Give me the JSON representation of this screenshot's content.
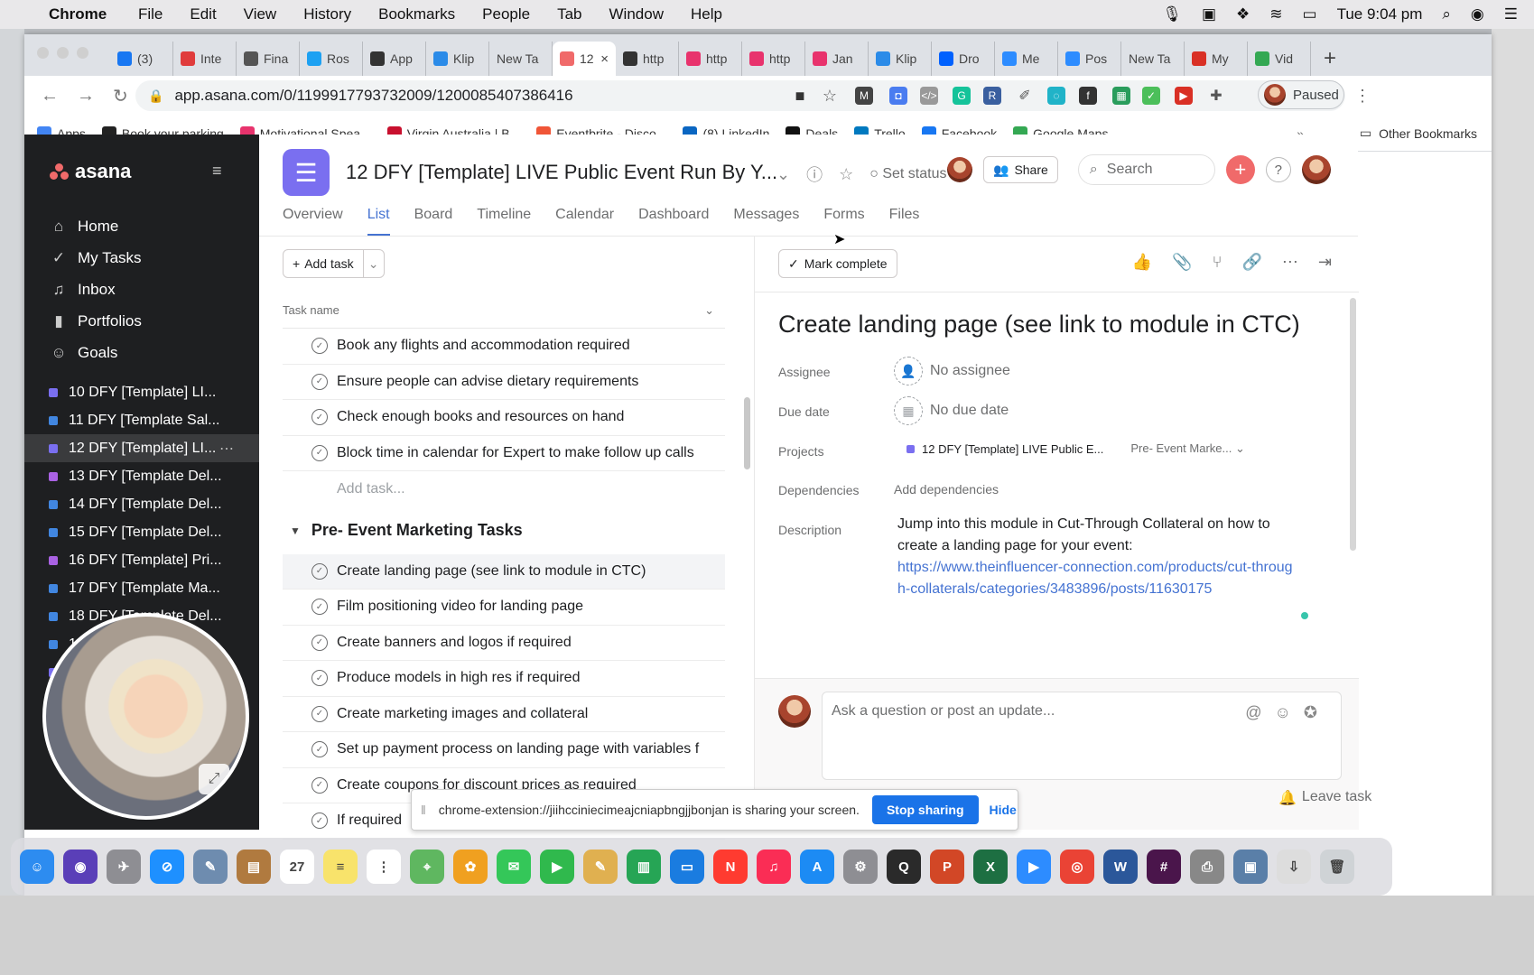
{
  "macos_menu": {
    "app": "Chrome",
    "items": [
      "File",
      "Edit",
      "View",
      "History",
      "Bookmarks",
      "People",
      "Tab",
      "Window",
      "Help"
    ],
    "clock": "Tue 9:04 pm"
  },
  "browser": {
    "tabs": [
      {
        "label": "(3)",
        "color": "#1877f2",
        "icon": "calendar-icon"
      },
      {
        "label": "Inte",
        "color": "#e03c3c",
        "icon": "card-icon"
      },
      {
        "label": "Fina",
        "color": "#555555",
        "icon": "doc-icon"
      },
      {
        "label": "Ros",
        "color": "#1da1f2",
        "icon": "twitter-icon"
      },
      {
        "label": "App",
        "color": "#333333",
        "icon": "globe-icon"
      },
      {
        "label": "Klip",
        "color": "#2b8be8",
        "icon": "klip-icon"
      },
      {
        "label": "New Ta",
        "color": "#ffffff",
        "icon": "none"
      },
      {
        "label": "12",
        "color": "#f06a6a",
        "icon": "recording-icon",
        "active": true
      },
      {
        "label": "http",
        "color": "#333333",
        "icon": "globe-icon"
      },
      {
        "label": "http",
        "color": "#e8336d",
        "icon": "pin-icon"
      },
      {
        "label": "http",
        "color": "#e8336d",
        "icon": "pin-icon"
      },
      {
        "label": "Jan",
        "color": "#e8336d",
        "icon": "pin-icon"
      },
      {
        "label": "Klip",
        "color": "#2b8be8",
        "icon": "klip-icon"
      },
      {
        "label": "Dro",
        "color": "#0061fe",
        "icon": "dropbox-icon"
      },
      {
        "label": "Me",
        "color": "#2d8cff",
        "icon": "zoom-icon"
      },
      {
        "label": "Pos",
        "color": "#2d8cff",
        "icon": "zoom-icon"
      },
      {
        "label": "New Ta",
        "color": "#ffffff",
        "icon": "none"
      },
      {
        "label": "My",
        "color": "#d93025",
        "icon": "video-icon"
      },
      {
        "label": "Vid",
        "color": "#34a853",
        "icon": "leaf-icon"
      }
    ],
    "url": "app.asana.com/0/1199917793732009/1200085407386416",
    "profile_label": "Paused"
  },
  "bookmarks": [
    {
      "label": "Apps",
      "color": "#4285f4"
    },
    {
      "label": "Book your parking",
      "color": "#222222"
    },
    {
      "label": "Motivational Spea...",
      "color": "#e8336d"
    },
    {
      "label": "Virgin Australia | B...",
      "color": "#c8102e"
    },
    {
      "label": "Eventbrite - Disco...",
      "color": "#f05537"
    },
    {
      "label": "(8) LinkedIn",
      "color": "#0a66c2"
    },
    {
      "label": "Deals",
      "color": "#111111"
    },
    {
      "label": "Trello",
      "color": "#0079bf"
    },
    {
      "label": "Facebook",
      "color": "#1877f2"
    },
    {
      "label": "Google Maps",
      "color": "#34a853"
    }
  ],
  "bookmarks_more": "»",
  "bookmarks_other": "Other Bookmarks",
  "sidebar": {
    "logo": "asana",
    "nav": [
      {
        "label": "Home",
        "icon": "home-icon"
      },
      {
        "label": "My Tasks",
        "icon": "check-circle-icon"
      },
      {
        "label": "Inbox",
        "icon": "bell-icon"
      },
      {
        "label": "Portfolios",
        "icon": "bar-chart-icon"
      },
      {
        "label": "Goals",
        "icon": "person-icon"
      }
    ],
    "projects": [
      {
        "label": "10 DFY [Template] LI...",
        "color": "#7a6ff0"
      },
      {
        "label": "11 DFY [Template Sal...",
        "color": "#4186e0"
      },
      {
        "label": "12 DFY [Template] LI...",
        "color": "#7a6ff0",
        "selected": true
      },
      {
        "label": "13 DFY [Template Del...",
        "color": "#aa62e3"
      },
      {
        "label": "14 DFY [Template Del...",
        "color": "#4186e0"
      },
      {
        "label": "15 DFY [Template Del...",
        "color": "#4186e0"
      },
      {
        "label": "16 DFY [Template] Pri...",
        "color": "#aa62e3"
      },
      {
        "label": "17 DFY [Template Ma...",
        "color": "#4186e0"
      },
      {
        "label": "18 DFY [Template Del...",
        "color": "#4186e0"
      },
      {
        "label": "19",
        "color": "#4186e0"
      },
      {
        "label": "",
        "color": "#7a6ff0"
      }
    ]
  },
  "project": {
    "title": "12 DFY [Template] LIVE Public Event Run By Y...",
    "set_status": "Set status",
    "share": "Share",
    "search_placeholder": "Search",
    "tabs": [
      "Overview",
      "List",
      "Board",
      "Timeline",
      "Calendar",
      "Dashboard",
      "Messages",
      "Forms",
      "Files"
    ],
    "active_tab": "List"
  },
  "list": {
    "add_task": "Add task",
    "column_header": "Task name",
    "tasks_top": [
      "Book any flights and accommodation required",
      "Ensure people can advise dietary requirements",
      "Check enough books and resources on hand",
      "Block time in calendar for Expert to make follow up calls"
    ],
    "add_task_inline": "Add task...",
    "section_title": "Pre- Event Marketing Tasks",
    "tasks_section": [
      "Create landing page (see link to module in CTC)",
      "Film positioning video for landing page",
      "Create banners and logos if required",
      "Produce models in high res if required",
      "Create marketing images and collateral",
      "Set up payment process on landing page with variables f",
      "Create coupons for discount prices as required",
      "If required"
    ]
  },
  "detail": {
    "mark_complete": "Mark complete",
    "title": "Create landing page (see link to module in CTC)",
    "fields": {
      "assignee_label": "Assignee",
      "assignee_value": "No assignee",
      "due_label": "Due date",
      "due_value": "No due date",
      "projects_label": "Projects",
      "project_name": "12 DFY [Template] LIVE Public E...",
      "project_section": "Pre- Event Marke...",
      "dependencies_label": "Dependencies",
      "dependencies_value": "Add dependencies",
      "description_label": "Description"
    },
    "description_text": "Jump into this module in Cut-Through Collateral on how to create a landing page for your event:",
    "description_link": "https://www.theinfluencer-connection.com/products/cut-through-collaterals/categories/3483896/posts/11630175",
    "comment_placeholder": "Ask a question or post an update...",
    "leave_task": "Leave task"
  },
  "screen_share": {
    "message": "chrome-extension://jiihcciniecimeajcniapbngjjbonjan is sharing your screen.",
    "stop": "Stop sharing",
    "hide": "Hide"
  },
  "dock": {
    "apps": [
      {
        "name": "finder",
        "color": "#2d8cf0",
        "glyph": "☺"
      },
      {
        "name": "siri",
        "color": "#5a3fb8",
        "glyph": "◉"
      },
      {
        "name": "launchpad",
        "color": "#8e8e93",
        "glyph": "✈"
      },
      {
        "name": "safari",
        "color": "#1e90ff",
        "glyph": "⊘"
      },
      {
        "name": "preview",
        "color": "#6e8caf",
        "glyph": "✎"
      },
      {
        "name": "contacts",
        "color": "#b07a3f",
        "glyph": "▤"
      },
      {
        "name": "calendar",
        "color": "#ffffff",
        "glyph": "27"
      },
      {
        "name": "notes",
        "color": "#f8e36b",
        "glyph": "≡"
      },
      {
        "name": "reminders",
        "color": "#ffffff",
        "glyph": "⋮"
      },
      {
        "name": "maps",
        "color": "#5fb760",
        "glyph": "⌖"
      },
      {
        "name": "photos",
        "color": "#f0a020",
        "glyph": "✿"
      },
      {
        "name": "messages",
        "color": "#34c759",
        "glyph": "✉"
      },
      {
        "name": "facetime",
        "color": "#30b94d",
        "glyph": "▶"
      },
      {
        "name": "textedit",
        "color": "#e0b050",
        "glyph": "✎"
      },
      {
        "name": "numbers",
        "color": "#26a555",
        "glyph": "▥"
      },
      {
        "name": "keynote",
        "color": "#1a7ce0",
        "glyph": "▭"
      },
      {
        "name": "news",
        "color": "#ff3b30",
        "glyph": "N"
      },
      {
        "name": "music",
        "color": "#fa2d55",
        "glyph": "♫"
      },
      {
        "name": "app-store",
        "color": "#1c8bf4",
        "glyph": "A"
      },
      {
        "name": "system-preferences",
        "color": "#8e8e93",
        "glyph": "⚙"
      },
      {
        "name": "quicktime",
        "color": "#2a2a2a",
        "glyph": "Q"
      },
      {
        "name": "powerpoint",
        "color": "#d24726",
        "glyph": "P"
      },
      {
        "name": "excel",
        "color": "#1d6f42",
        "glyph": "X"
      },
      {
        "name": "zoom",
        "color": "#2d8cff",
        "glyph": "▶"
      },
      {
        "name": "chrome",
        "color": "#ea4335",
        "glyph": "◎"
      },
      {
        "name": "word",
        "color": "#2b579a",
        "glyph": "W"
      },
      {
        "name": "slack",
        "color": "#4a154b",
        "glyph": "#"
      },
      {
        "name": "printer",
        "color": "#888888",
        "glyph": "⎙"
      },
      {
        "name": "image-capture",
        "color": "#5a7fa8",
        "glyph": "▣"
      },
      {
        "name": "downloads",
        "color": "#dddddd",
        "glyph": "⇩"
      },
      {
        "name": "trash",
        "color": "#cfd3d6",
        "glyph": "🗑"
      }
    ]
  }
}
